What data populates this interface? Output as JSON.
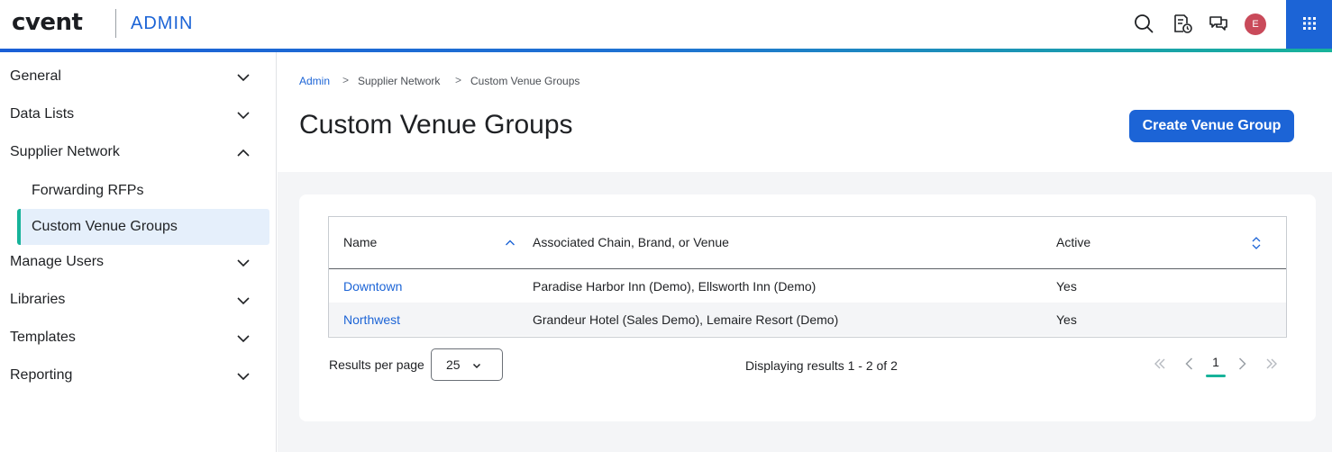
{
  "header": {
    "logo": "cvent",
    "app_name": "ADMIN",
    "avatar_initial": "E",
    "icons": [
      "search-icon",
      "report-clock-icon",
      "chat-icon",
      "apps-grid-icon"
    ],
    "accent_color": "#1c64d6"
  },
  "sidebar": {
    "items": [
      {
        "label": "General",
        "expanded": false
      },
      {
        "label": "Data Lists",
        "expanded": false
      },
      {
        "label": "Supplier Network",
        "expanded": true
      },
      {
        "label": "Manage Users",
        "expanded": false
      },
      {
        "label": "Libraries",
        "expanded": false
      },
      {
        "label": "Templates",
        "expanded": false
      },
      {
        "label": "Reporting",
        "expanded": false
      }
    ],
    "sub_items": [
      {
        "label": "Forwarding RFPs",
        "active": false
      },
      {
        "label": "Custom Venue Groups",
        "active": true
      }
    ]
  },
  "breadcrumb": [
    "Admin",
    "Supplier Network",
    "Custom Venue Groups"
  ],
  "page": {
    "title": "Custom Venue Groups",
    "create_button": "Create Venue Group"
  },
  "table": {
    "columns": [
      "Name",
      "Associated Chain, Brand, or Venue",
      "Active"
    ],
    "sort_column": "Name",
    "sort_direction": "ascending",
    "rows": [
      {
        "name": "Downtown",
        "associated": "Paradise Harbor Inn (Demo), Ellsworth Inn (Demo)",
        "active": "Yes"
      },
      {
        "name": "Northwest",
        "associated": "Grandeur Hotel (Sales Demo), Lemaire Resort (Demo)",
        "active": "Yes"
      }
    ]
  },
  "pagination": {
    "results_per_page_label": "Results per page",
    "results_per_page": "25",
    "displaying": "Displaying results 1 - 2 of 2",
    "current_page": "1"
  }
}
